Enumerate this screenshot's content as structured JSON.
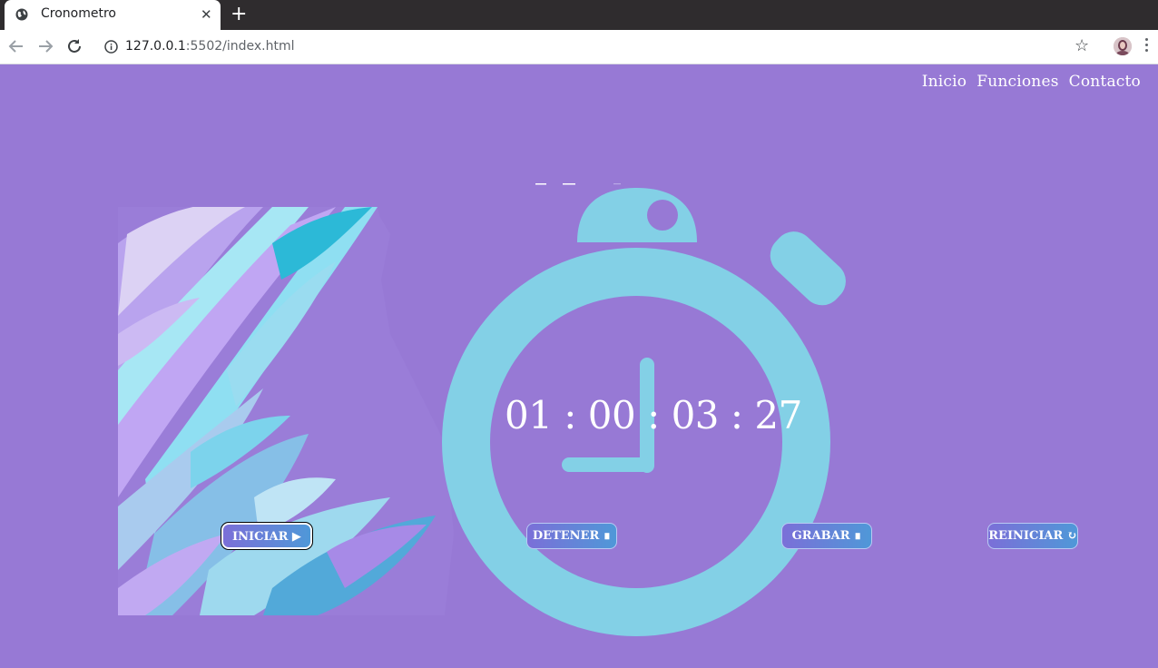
{
  "browser": {
    "tab_title": "Cronometro",
    "url_host": "127.0.0.1",
    "url_rest": ":5502/index.html"
  },
  "nav": {
    "items": [
      "Inicio",
      "Funciones",
      "Contacto"
    ]
  },
  "timer": {
    "display": "01 : 00 : 03 : 27"
  },
  "buttons": {
    "start": "INICIAR ▶",
    "stop": "DETENER ∎",
    "record": "GRABAR ∎",
    "reset": "REINICIAR ↻"
  },
  "colors": {
    "page_background": "#9779d5",
    "stopwatch": "#83d0e6",
    "button_gradient_start": "#7b6fd8",
    "button_gradient_end": "#4f98d8"
  }
}
